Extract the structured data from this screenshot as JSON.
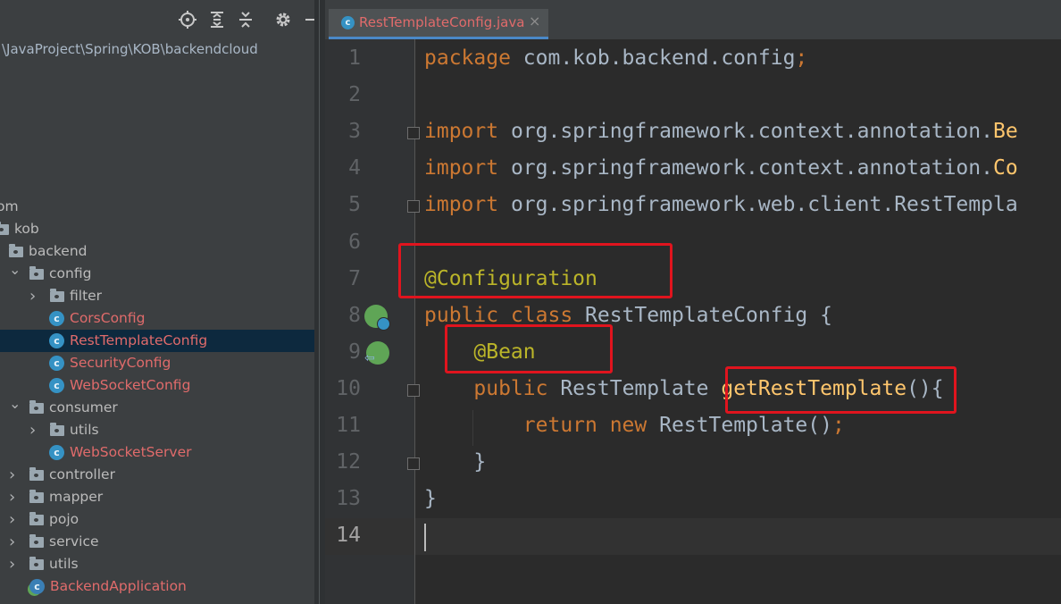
{
  "project_panel": {
    "path": "\\JavaProject\\Spring\\KOB\\backendcloud",
    "toolbar": {
      "locate_icon": "crosshair-icon",
      "expand_icon": "expand-all-icon",
      "collapse_icon": "collapse-all-icon",
      "settings_icon": "gear-icon",
      "hide_icon": "minimize-icon"
    },
    "tree": [
      {
        "label": "om",
        "type": "none",
        "indent": 0
      },
      {
        "label": "kob",
        "type": "folder",
        "indent": 0
      },
      {
        "label": "backend",
        "type": "folder",
        "indent": 1
      },
      {
        "label": "config",
        "type": "folder",
        "indent": 1,
        "expanded": true
      },
      {
        "label": "filter",
        "type": "folder",
        "indent": 2,
        "expanded": false
      },
      {
        "label": "CorsConfig",
        "type": "class",
        "indent": 2
      },
      {
        "label": "RestTemplateConfig",
        "type": "class",
        "indent": 2,
        "selected": true
      },
      {
        "label": "SecurityConfig",
        "type": "class",
        "indent": 2
      },
      {
        "label": "WebSocketConfig",
        "type": "class",
        "indent": 2
      },
      {
        "label": "consumer",
        "type": "folder",
        "indent": 1,
        "expanded": true
      },
      {
        "label": "utils",
        "type": "folder",
        "indent": 2,
        "expanded": false
      },
      {
        "label": "WebSocketServer",
        "type": "class",
        "indent": 2
      },
      {
        "label": "controller",
        "type": "folder",
        "indent": 1,
        "expanded": false
      },
      {
        "label": "mapper",
        "type": "folder",
        "indent": 1,
        "expanded": false
      },
      {
        "label": "pojo",
        "type": "folder",
        "indent": 1,
        "expanded": false
      },
      {
        "label": "service",
        "type": "folder",
        "indent": 1,
        "expanded": false
      },
      {
        "label": "utils",
        "type": "folder",
        "indent": 1,
        "expanded": false
      },
      {
        "label": "BackendApplication",
        "type": "spring-class",
        "indent": 1
      }
    ]
  },
  "editor": {
    "tab": {
      "label": "RestTemplateConfig.java",
      "close": "×"
    },
    "line_numbers": [
      "1",
      "2",
      "3",
      "4",
      "5",
      "6",
      "7",
      "8",
      "9",
      "10",
      "11",
      "12",
      "13",
      "14"
    ],
    "lines": [
      [
        [
          "kw",
          "package "
        ],
        [
          "plain",
          "com.kob.backend.config"
        ],
        [
          "kw",
          ";"
        ]
      ],
      [],
      [
        [
          "kw",
          "import "
        ],
        [
          "plain",
          "org.springframework.context.annotation."
        ],
        [
          "fn",
          "Be"
        ]
      ],
      [
        [
          "kw",
          "import "
        ],
        [
          "plain",
          "org.springframework.context.annotation."
        ],
        [
          "fn",
          "Co"
        ]
      ],
      [
        [
          "kw",
          "import "
        ],
        [
          "plain",
          "org.springframework.web.client.RestTempla"
        ]
      ],
      [],
      [
        [
          "an",
          "@Configuration"
        ]
      ],
      [
        [
          "kw",
          "public class "
        ],
        [
          "plain",
          "RestTemplateConfig {"
        ]
      ],
      [
        [
          "plain",
          "    "
        ],
        [
          "an",
          "@Bean"
        ]
      ],
      [
        [
          "plain",
          "    "
        ],
        [
          "kw",
          "public "
        ],
        [
          "plain",
          "RestTemplate "
        ],
        [
          "fn",
          "getRestTemplate"
        ],
        [
          "plain",
          "(){"
        ]
      ],
      [
        [
          "plain",
          "        "
        ],
        [
          "kw",
          "return new "
        ],
        [
          "plain",
          "RestTemplate()"
        ],
        [
          "kw",
          ";"
        ]
      ],
      [
        [
          "plain",
          "    }"
        ]
      ],
      [
        [
          "plain",
          "}"
        ]
      ],
      []
    ],
    "colors": {
      "keyword": "#cc7832",
      "annotation": "#bbb529",
      "method": "#ffc66d",
      "plain": "#a9b7c6",
      "highlight_box": "#e0141e"
    }
  }
}
